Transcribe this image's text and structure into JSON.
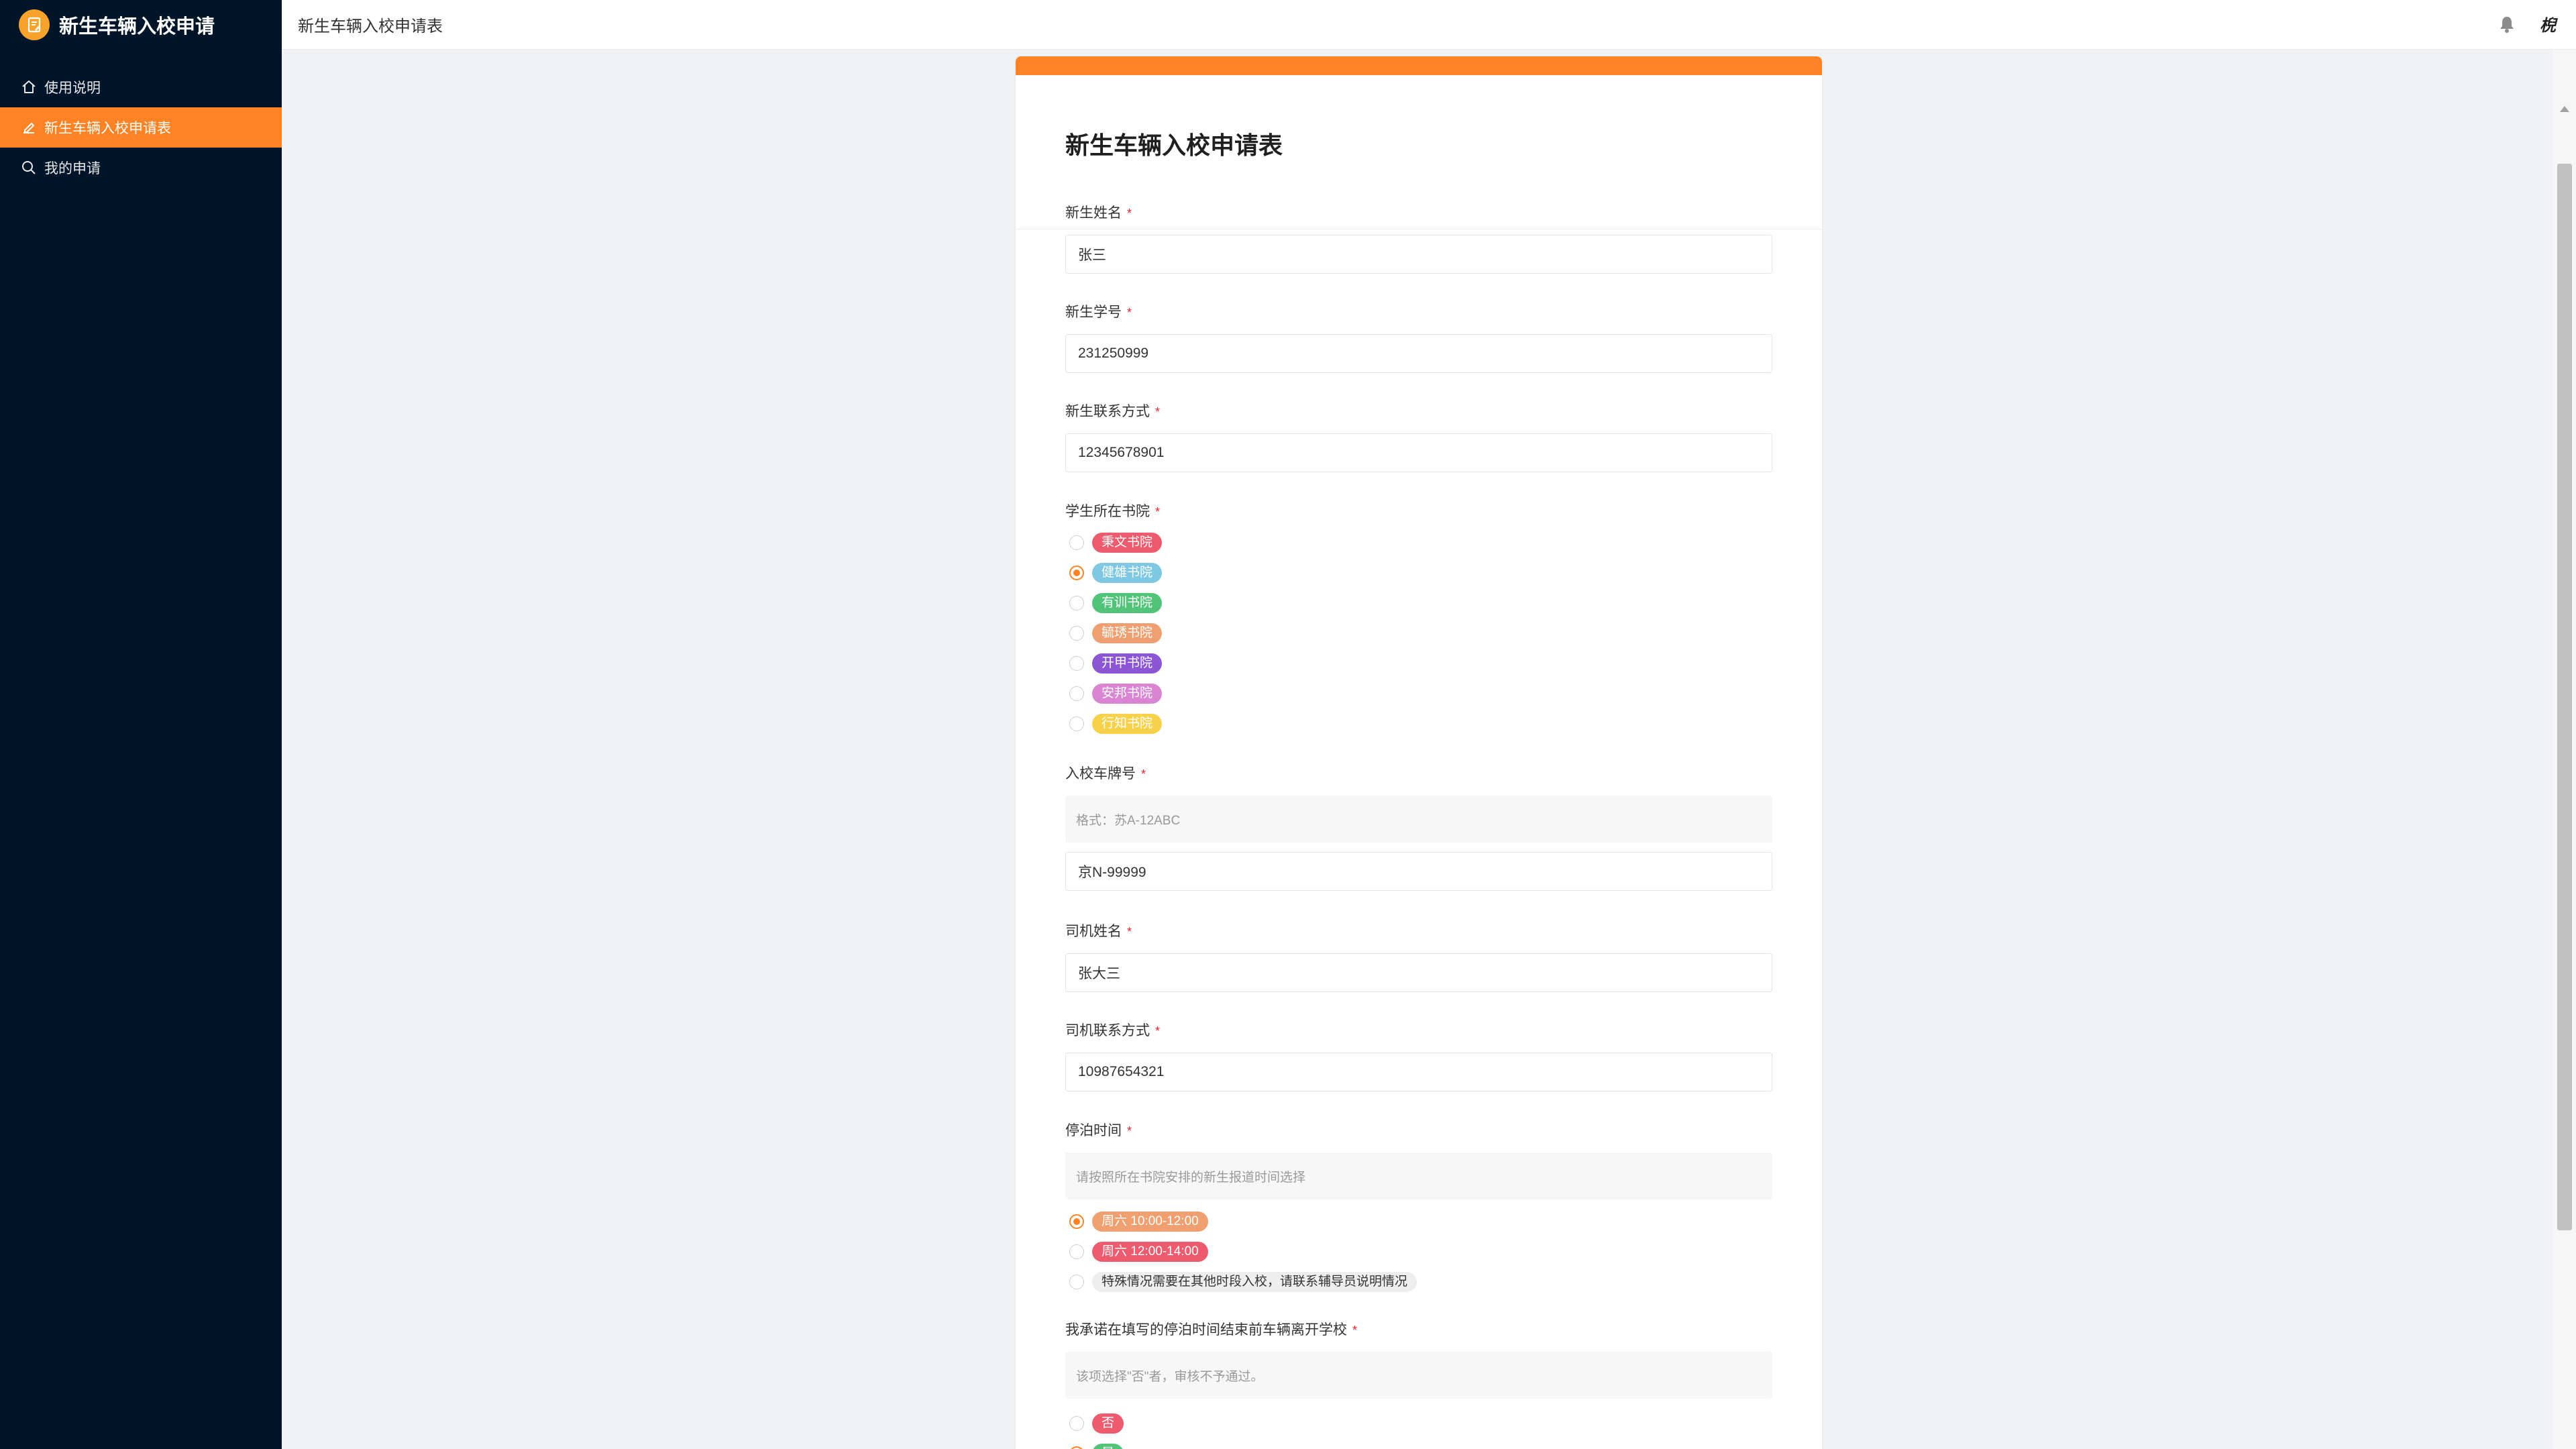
{
  "app": {
    "brand_title": "新生车辆入校申请"
  },
  "sidebar": {
    "items": [
      {
        "label": "使用说明",
        "icon": "home-icon"
      },
      {
        "label": "新生车辆入校申请表",
        "icon": "edit-icon"
      },
      {
        "label": "我的申请",
        "icon": "search-icon"
      }
    ]
  },
  "header": {
    "title": "新生车辆入校申请表",
    "avatar_text": "棿"
  },
  "form": {
    "title": "新生车辆入校申请表",
    "student_name": {
      "label": "新生姓名",
      "value": "张三"
    },
    "student_id": {
      "label": "新生学号",
      "value": "231250999"
    },
    "student_contact": {
      "label": "新生联系方式",
      "value": "12345678901"
    },
    "college": {
      "label": "学生所在书院",
      "options": [
        {
          "label": "秉文书院",
          "color": "#ef5b6e",
          "checked": false
        },
        {
          "label": "健雄书院",
          "color": "#7ec8e3",
          "checked": true
        },
        {
          "label": "有训书院",
          "color": "#52c47a",
          "checked": false
        },
        {
          "label": "毓琇书院",
          "color": "#f0a070",
          "checked": false
        },
        {
          "label": "开甲书院",
          "color": "#8b55d6",
          "checked": false
        },
        {
          "label": "安邦书院",
          "color": "#d985d4",
          "checked": false
        },
        {
          "label": "行知书院",
          "color": "#f7d14a",
          "checked": false
        }
      ]
    },
    "plate": {
      "label": "入校车牌号",
      "hint": "格式：苏A-12ABC",
      "value": "京N-99999"
    },
    "driver_name": {
      "label": "司机姓名",
      "value": "张大三"
    },
    "driver_contact": {
      "label": "司机联系方式",
      "value": "10987654321"
    },
    "parking_time": {
      "label": "停泊时间",
      "hint": "请按照所在书院安排的新生报道时间选择",
      "options": [
        {
          "label": "周六 10:00-12:00",
          "color": "#f0a070",
          "checked": true
        },
        {
          "label": "周六 12:00-14:00",
          "color": "#ef5b6e",
          "checked": false
        },
        {
          "label": "特殊情况需要在其他时段入校，请联系辅导员说明情况",
          "color": "#eeeeee",
          "checked": false
        }
      ]
    },
    "promise": {
      "label": "我承诺在填写的停泊时间结束前车辆离开学校",
      "hint": "该项选择\"否\"者，审核不予通过。",
      "options": [
        {
          "label": "否",
          "color": "#ef5b6e",
          "checked": false
        },
        {
          "label": "是",
          "color": "#52c47a",
          "checked": true
        }
      ]
    }
  }
}
